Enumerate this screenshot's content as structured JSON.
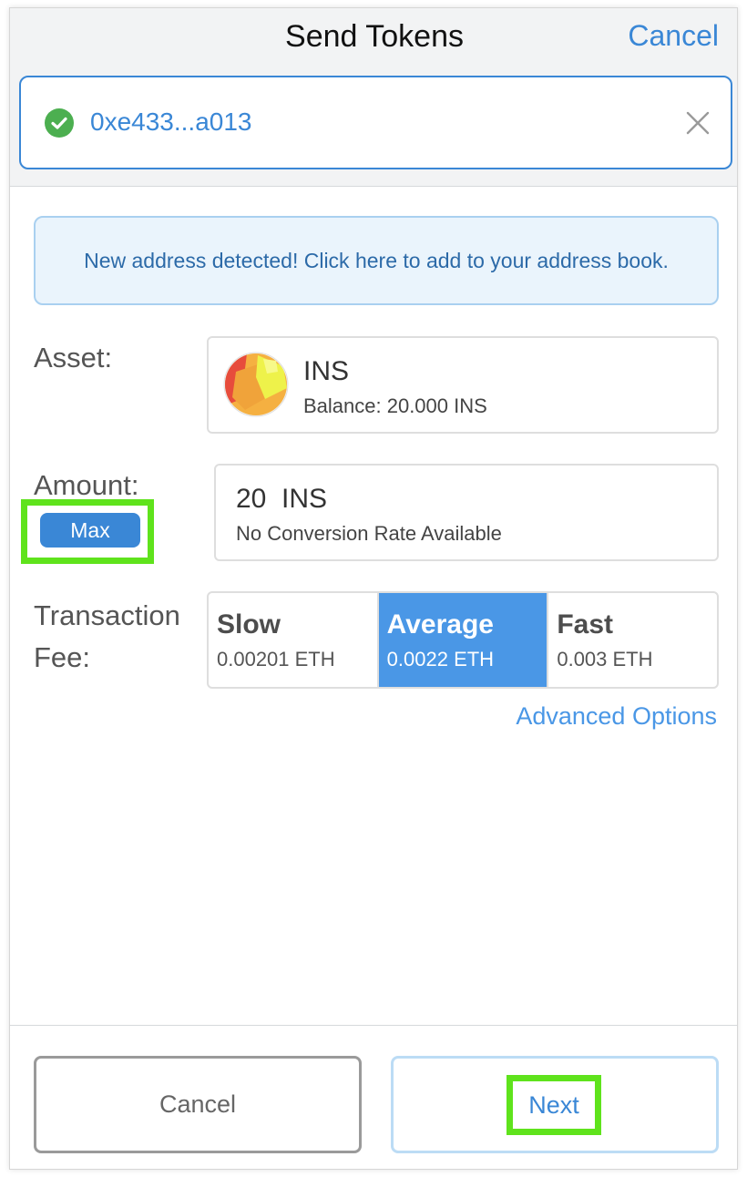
{
  "header": {
    "title": "Send Tokens",
    "cancel_label": "Cancel"
  },
  "recipient": {
    "address": "0xe433...a013",
    "valid_icon": "check-circle-icon",
    "clear_icon": "close-icon"
  },
  "notice": {
    "text": "New address detected! Click here to add to your address book."
  },
  "asset": {
    "label": "Asset:",
    "symbol": "INS",
    "balance": "Balance: 20.000 INS"
  },
  "amount": {
    "label": "Amount:",
    "max_label": "Max",
    "value": "20  INS",
    "conversion": "No Conversion Rate Available"
  },
  "fee": {
    "label_line1": "Transaction",
    "label_line2": "Fee:",
    "options": [
      {
        "name": "Slow",
        "value": "0.00201 ETH",
        "selected": false
      },
      {
        "name": "Average",
        "value": "0.0022 ETH",
        "selected": true
      },
      {
        "name": "Fast",
        "value": "0.003 ETH",
        "selected": false
      }
    ],
    "advanced_label": "Advanced Options"
  },
  "footer": {
    "cancel_label": "Cancel",
    "next_label": "Next"
  },
  "colors": {
    "accent": "#3a87d6",
    "selected_fee": "#4a97e6",
    "highlight": "#5fe31c",
    "valid": "#4caf50"
  }
}
